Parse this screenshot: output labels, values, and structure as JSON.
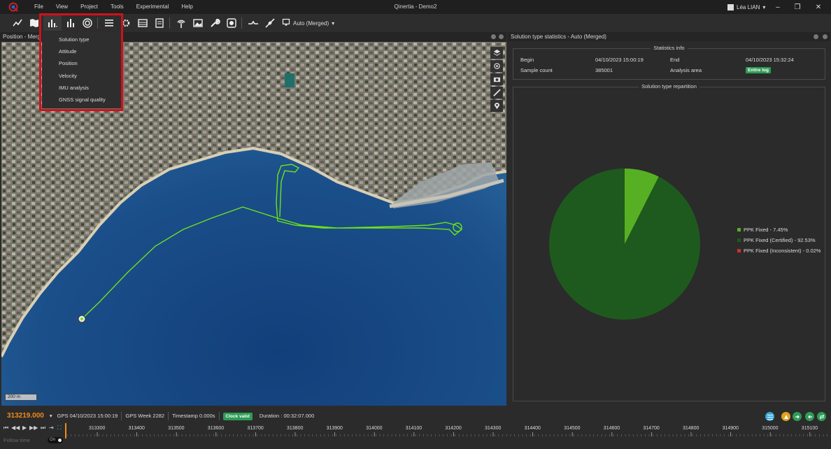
{
  "app": {
    "title": "Qinertia - Demo2",
    "user": "Léa LIAN"
  },
  "menu": [
    "File",
    "View",
    "Project",
    "Tools",
    "Experimental",
    "Help"
  ],
  "window_controls": {
    "minimize": "–",
    "maximize": "❐",
    "close": "✕"
  },
  "toolbar": {
    "icons": [
      "line-chart-icon",
      "map-icon",
      "bar-chart-icon",
      "stats-icon",
      "target-icon",
      "list-icon",
      "gear-icon",
      "table-icon",
      "layers-icon",
      "antenna-icon",
      "image-icon",
      "wrench-icon",
      "processing-icon",
      "path-icon",
      "satellite-icon",
      "monitor-icon"
    ],
    "solution_selector": "Auto (Merged)"
  },
  "dropdown": {
    "items": [
      "Solution type",
      "Attitude",
      "Position",
      "Velocity",
      "IMU analysis",
      "GNSS signal quality"
    ]
  },
  "map_panel": {
    "title": "Position - Merg",
    "scale": "200 m"
  },
  "stats_panel": {
    "title": "Solution type statistics - Auto (Merged)",
    "info": {
      "title": "Statistics info",
      "begin_label": "Begin",
      "begin_value": "04/10/2023 15:00:19",
      "end_label": "End",
      "end_value": "04/10/2023 15:32:24",
      "sample_count_label": "Sample count",
      "sample_count_value": "385001",
      "analysis_area_label": "Analysis area",
      "analysis_area_value": "Entire log"
    },
    "repartition_title": "Solution type repartition"
  },
  "chart_data": {
    "type": "pie",
    "title": "Solution type repartition",
    "series": [
      {
        "name": "PPK Fixed - 7.45%",
        "value": 7.45,
        "color": "#57b023"
      },
      {
        "name": "PPK Fixed (Certified) - 92.53%",
        "value": 92.53,
        "color": "#1e5a1e"
      },
      {
        "name": "PPK Fixed (Inconsistent) - 0.02%",
        "value": 0.02,
        "color": "#d0302a"
      }
    ],
    "legend": "right"
  },
  "status": {
    "time": "313219.000",
    "gps_date": "GPS 04/10/2023 15:00:19",
    "gps_week": "GPS Week 2282",
    "timestamp": "Timestamp 0.000s",
    "clock": "Clock valid",
    "duration": "Duration : 00:32:07.000"
  },
  "timeline": {
    "ticks": [
      "313300",
      "313400",
      "313500",
      "313600",
      "313700",
      "313800",
      "313900",
      "314000",
      "314100",
      "314200",
      "314300",
      "314400",
      "314500",
      "314600",
      "314700",
      "314800",
      "314900",
      "315000",
      "315100"
    ],
    "follow_label": "Follow time",
    "follow_state": "On",
    "controls": [
      "⏮",
      "◀◀",
      "▶",
      "▶▶",
      "⏭"
    ]
  }
}
